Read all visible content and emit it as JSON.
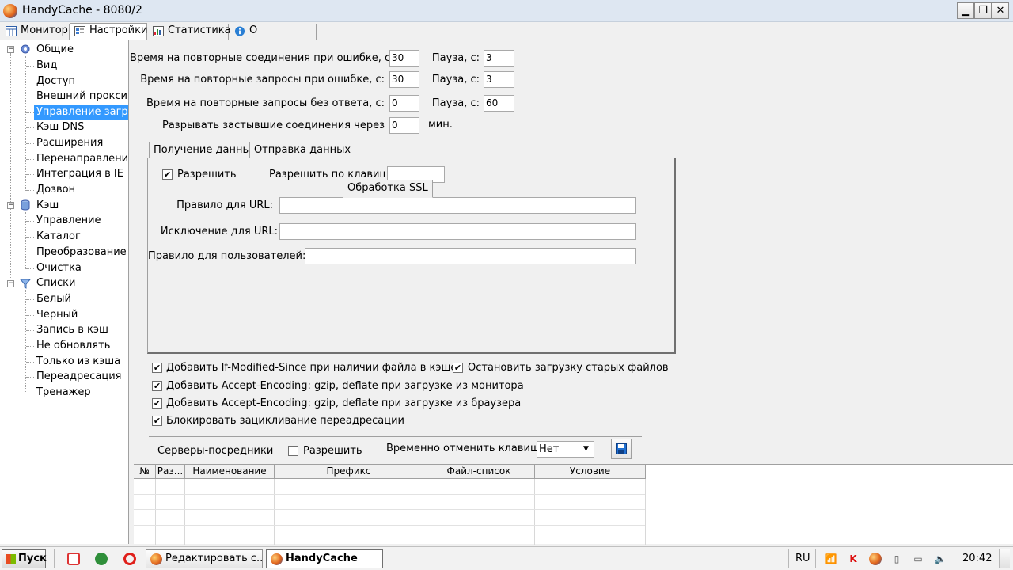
{
  "window": {
    "title": "HandyCache - 8080/2",
    "minimize": "▁",
    "restore": "❐",
    "close": "✕"
  },
  "tabs": [
    {
      "label": "Монитор",
      "icon": "monitor-icon"
    },
    {
      "label": "Настройки",
      "icon": "settings-icon"
    },
    {
      "label": "Статистика",
      "icon": "statistics-icon"
    },
    {
      "label": "О программе",
      "icon": "info-icon"
    }
  ],
  "tree": {
    "general": {
      "label": "Общие",
      "icon": "gear-icon"
    },
    "general_items": [
      "Вид",
      "Доступ",
      "Внешний прокси",
      "Управление загру",
      "Кэш DNS",
      "Расширения",
      "Перенаправление",
      "Интеграция в IE",
      "Дозвон"
    ],
    "cache": {
      "label": "Кэш",
      "icon": "database-icon"
    },
    "cache_items": [
      "Управление",
      "Каталог",
      "Преобразование U",
      "Очистка"
    ],
    "lists": {
      "label": "Списки",
      "icon": "filter-icon"
    },
    "lists_items": [
      "Белый",
      "Черный",
      "Запись в кэш",
      "Не обновлять",
      "Только из кэша",
      "Переадресация",
      "Тренажер"
    ]
  },
  "timeouts": [
    {
      "label": "Время на повторные соединения при ошибке, с:",
      "value": "30",
      "pause_label": "Пауза, с:",
      "pause": "3"
    },
    {
      "label": "Время на повторные запросы при ошибке, с:",
      "value": "30",
      "pause_label": "Пауза, с:",
      "pause": "3"
    },
    {
      "label": "Время на повторные запросы без ответа, с:",
      "value": "0",
      "pause_label": "Пауза, с:",
      "pause": "60"
    }
  ],
  "stalled": {
    "label": "Разрывать застывшие соединения через",
    "value": "0",
    "unit": "мин."
  },
  "subtabs": [
    "Получение данных",
    "Отправка данных",
    "Обработка SSL"
  ],
  "ssl": {
    "allow_label": "Разрешить",
    "allow_checked": "✔",
    "hotkey_label": "Разрешить по клавише:",
    "hotkey_value": "",
    "url_rule_label": "Правило для URL:",
    "url_rule_value": "",
    "url_exclude_label": "Исключение для URL:",
    "url_exclude_value": "",
    "user_rule_label": "Правило для пользователей:",
    "user_rule_value": ""
  },
  "options": [
    {
      "label": "Добавить If-Modified-Since при наличии файла в кэше",
      "mark": "✔"
    },
    {
      "label": "Остановить загрузку старых файлов",
      "mark": "✔"
    },
    {
      "label": "Добавить Accept-Encoding: gzip, deflate при загрузке из монитора",
      "mark": "✔"
    },
    {
      "label": "Добавить Accept-Encoding: gzip, deflate при загрузке из браузера",
      "mark": "✔"
    },
    {
      "label": "Блокировать зацикливание переадресации",
      "mark": "✔"
    }
  ],
  "proxies": {
    "label": "Серверы-посредники",
    "allow_label": "Разрешить",
    "allow_mark": "",
    "cancel_label": "Временно отменить клавишей:",
    "cancel_value": "Нет",
    "arrow": "▼"
  },
  "grid": {
    "columns": [
      "№",
      "Раз...",
      "Наименование",
      "Префикс",
      "Файл-список",
      "Условие"
    ]
  },
  "taskbar": {
    "start": "Пуск",
    "tasks": [
      "Редактировать с...",
      "HandyCache"
    ],
    "lang": "RU",
    "time": "20:42"
  }
}
